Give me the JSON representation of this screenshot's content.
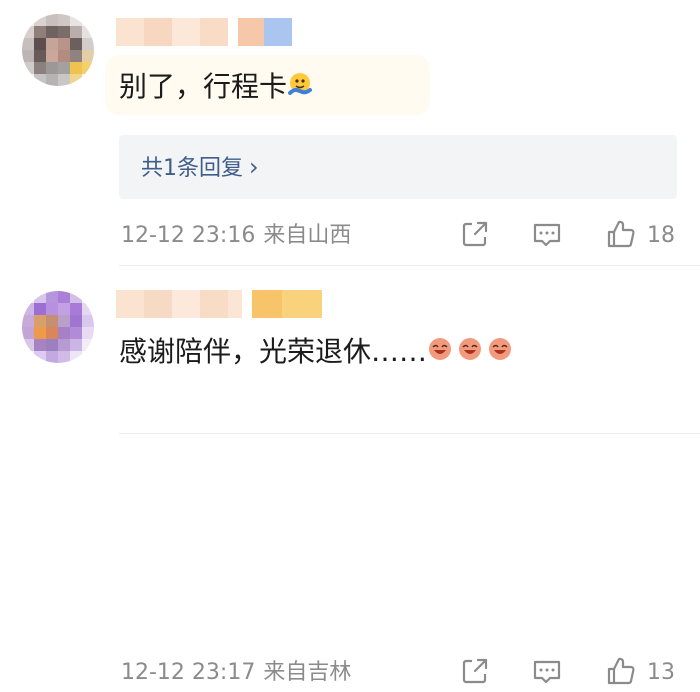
{
  "comments": [
    {
      "text": "别了，行程卡",
      "emoji": "wave-emoji",
      "replies": {
        "label": "共1条回复",
        "chevron": "›"
      },
      "time": "12-12 23:16",
      "location": "来自山西",
      "likes": "18"
    },
    {
      "text": "感谢陪伴，光荣退休……",
      "emoji": "laughing-emoji",
      "time": "12-12 23:17",
      "location": "来自吉林",
      "likes": "13"
    }
  ],
  "colors": {
    "reply_link": "#3f5d8a",
    "meta_gray": "#8b8b8b",
    "reply_bg": "#f3f4f6"
  },
  "icons": [
    "share-icon",
    "comment-icon",
    "like-icon"
  ]
}
